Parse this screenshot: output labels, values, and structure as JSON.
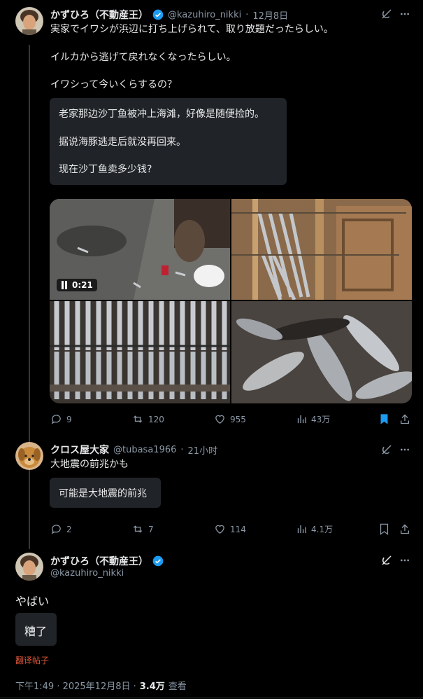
{
  "colors": {
    "background": "#000000",
    "text": "#e7e9ea",
    "muted": "#8b98a5",
    "bookmark_active": "#1d9bf0",
    "verified": "#1d9bf0",
    "translate_link": "#e0593a",
    "translation_box": "#202327"
  },
  "post1": {
    "author_name": "かずひろ（不動産王）",
    "handle": "@kazuhiro_nikki",
    "date": "12月8日",
    "text": [
      "実家でイワシが浜辺に打ち上げられて、取り放題だったらしい。",
      "イルカから逃げて戻れなくなったらしい。",
      "イワシって今いくらするの？"
    ],
    "translation": [
      "老家那边沙丁鱼被冲上海滩，好像是随便捡的。",
      "据说海豚逃走后就没再回来。",
      "现在沙丁鱼卖多少钱?"
    ],
    "video_time": "0:21",
    "actions": {
      "replies": "9",
      "reposts": "120",
      "likes": "955",
      "views": "43万"
    },
    "icons": [
      "grok-icon",
      "more-icon",
      "reply-icon",
      "repost-icon",
      "like-icon",
      "views-icon",
      "bookmark-icon",
      "share-icon",
      "pause-icon",
      "verified-badge-icon"
    ]
  },
  "post2": {
    "author_name": "クロス屋大家",
    "handle": "@tubasa1966",
    "time": "21小时",
    "text": "大地震の前兆かも",
    "translation": "可能是大地震的前兆",
    "actions": {
      "replies": "2",
      "reposts": "7",
      "likes": "114",
      "views": "4.1万"
    }
  },
  "post3": {
    "author_name": "かずひろ（不動産王）",
    "handle": "@kazuhiro_nikki",
    "text": "やばい",
    "translation": "糟了",
    "translate_label": "翻译帖子",
    "time_date": "下午1:49 · 2025年12月8日 ·",
    "views_count": "3.4万",
    "views_label": "查看"
  }
}
